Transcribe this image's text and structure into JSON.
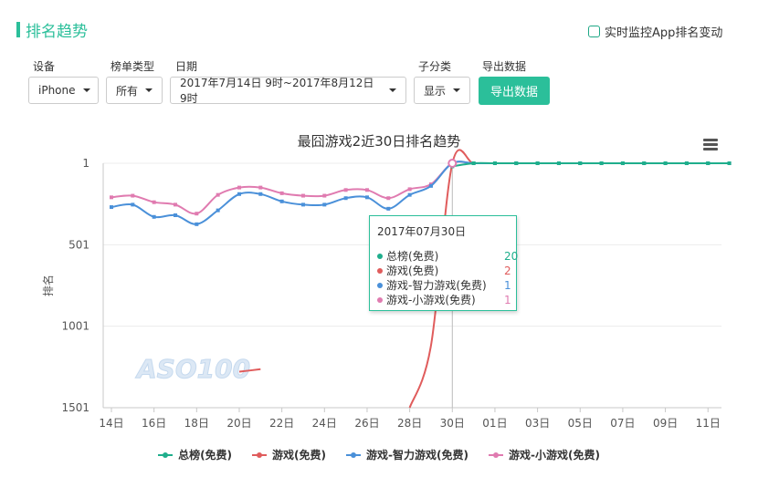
{
  "page": {
    "title": "排名趋势",
    "monitor_label": "实时监控App排名变动"
  },
  "filters": {
    "device": {
      "label": "设备",
      "value": "iPhone"
    },
    "list_type": {
      "label": "榜单类型",
      "value": "所有"
    },
    "date": {
      "label": "日期",
      "value": "2017年7月14日 9时~2017年8月12日 9时"
    },
    "subcategory": {
      "label": "子分类",
      "value": "显示"
    },
    "export": {
      "label": "导出数据",
      "button": "导出数据"
    }
  },
  "colors": {
    "accent": "#2bbf9a",
    "series_overall": "#1fae8c",
    "series_games": "#e05c5c",
    "series_puzzle": "#4a90d9",
    "series_casual": "#e07bb0"
  },
  "watermark": "ASO100",
  "tooltip": {
    "date": "2017年07月30日",
    "rows": [
      {
        "name": "总榜(免费)",
        "value": "20"
      },
      {
        "name": "游戏(免费)",
        "value": "2"
      },
      {
        "name": "游戏-智力游戏(免费)",
        "value": "1"
      },
      {
        "name": "游戏-小游戏(免费)",
        "value": "1"
      }
    ]
  },
  "chart_data": {
    "type": "line",
    "title": "最囧游戏2近30日排名趋势",
    "ylabel": "排名",
    "y_reversed": true,
    "ylim": [
      1,
      1501
    ],
    "yticks": [
      "1",
      "501",
      "1001",
      "1501"
    ],
    "xticks": [
      "14日",
      "16日",
      "18日",
      "20日",
      "22日",
      "24日",
      "26日",
      "28日",
      "30日",
      "01日",
      "03日",
      "05日",
      "07日",
      "09日",
      "11日"
    ],
    "x": [
      14,
      15,
      16,
      17,
      18,
      19,
      20,
      21,
      22,
      23,
      24,
      25,
      26,
      27,
      28,
      29,
      30,
      31,
      32,
      33,
      34,
      35,
      36,
      37,
      38,
      39,
      40,
      41,
      42,
      43
    ],
    "series": [
      {
        "name": "总榜(免费)",
        "values": [
          null,
          null,
          null,
          null,
          null,
          null,
          null,
          null,
          null,
          null,
          null,
          null,
          null,
          null,
          null,
          null,
          20,
          1,
          1,
          1,
          1,
          1,
          1,
          1,
          1,
          1,
          1,
          1,
          1,
          1
        ]
      },
      {
        "name": "游戏(免费)",
        "values": [
          null,
          null,
          null,
          null,
          null,
          null,
          1280,
          1265,
          null,
          null,
          null,
          null,
          null,
          null,
          1501,
          1120,
          2,
          1,
          1,
          1,
          1,
          1,
          1,
          1,
          1,
          1,
          1,
          1,
          1,
          1
        ]
      },
      {
        "name": "游戏-智力游戏(免费)",
        "values": [
          270,
          255,
          330,
          320,
          375,
          290,
          190,
          190,
          235,
          255,
          255,
          215,
          210,
          280,
          195,
          140,
          1,
          1,
          1,
          1,
          1,
          1,
          1,
          1,
          1,
          1,
          1,
          1,
          1,
          1
        ]
      },
      {
        "name": "游戏-小游戏(免费)",
        "values": [
          210,
          200,
          240,
          255,
          310,
          195,
          150,
          150,
          185,
          200,
          200,
          165,
          165,
          215,
          160,
          130,
          1,
          1,
          1,
          1,
          1,
          1,
          1,
          1,
          1,
          1,
          1,
          1,
          1,
          1
        ]
      }
    ],
    "crosshair_x": 30,
    "grid": true,
    "legend_position": "bottom"
  }
}
